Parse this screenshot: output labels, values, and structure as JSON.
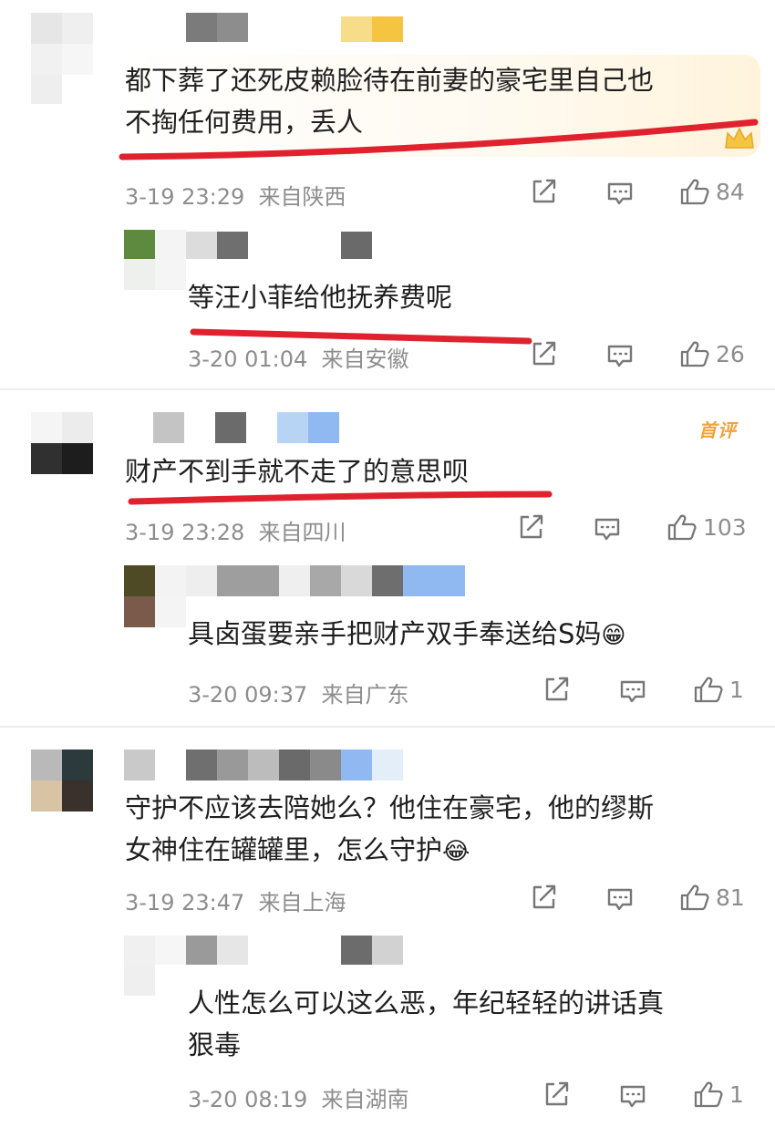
{
  "comments": [
    {
      "text_lines": [
        "都下葬了还死皮赖脸待在前妻的豪宅里自己也",
        "不掏任何费用，丢人"
      ],
      "time": "3-19 23:29",
      "location": "来自陕西",
      "likes": "84",
      "replies": [
        {
          "text_lines": [
            "等汪小菲给他抚养费呢"
          ],
          "time": "3-20 01:04",
          "location": "来自安徽",
          "likes": "26"
        }
      ]
    },
    {
      "badge": "首评",
      "text_lines": [
        "财产不到手就不走了的意思呗"
      ],
      "time": "3-19 23:28",
      "location": "来自四川",
      "likes": "103",
      "replies": [
        {
          "text_lines": [
            "具卤蛋要亲手把财产双手奉送给S妈"
          ],
          "emoji": "😁",
          "time": "3-20 09:37",
          "location": "来自广东",
          "likes": "1"
        }
      ]
    },
    {
      "text_lines": [
        "守护不应该去陪她么？他住在豪宅，他的缪斯",
        "女神住在罐罐里，怎么守护"
      ],
      "emoji": "😂",
      "time": "3-19 23:47",
      "location": "来自上海",
      "likes": "81",
      "replies": [
        {
          "text_lines": [
            "人性怎么可以这么恶，年纪轻轻的讲话真",
            "狠毒"
          ],
          "time": "3-20 08:19",
          "location": "来自湖南",
          "likes": "1"
        }
      ]
    }
  ],
  "colors": {
    "underline": "#e0212e",
    "meta": "#8d8d8d",
    "badge": "#f0a43a"
  },
  "icons": [
    "share-icon",
    "comment-icon",
    "thumbs-up-icon"
  ]
}
